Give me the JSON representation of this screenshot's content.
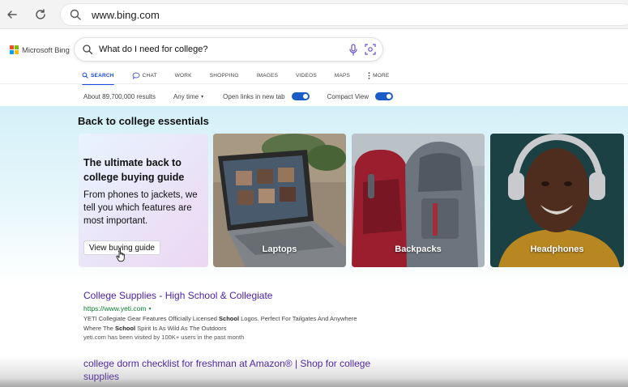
{
  "browser": {
    "url": "www.bing.com"
  },
  "bing": {
    "logo_text": "Microsoft Bing",
    "search_query": "What do I need for college?",
    "tabs": [
      {
        "label": "SEARCH",
        "icon": "search-icon",
        "active": true
      },
      {
        "label": "CHAT",
        "icon": "chat-icon",
        "active": false
      },
      {
        "label": "WORK",
        "icon": "",
        "active": false
      },
      {
        "label": "SHOPPING",
        "icon": "",
        "active": false
      },
      {
        "label": "IMAGES",
        "icon": "",
        "active": false
      },
      {
        "label": "VIDEOS",
        "icon": "",
        "active": false
      },
      {
        "label": "MAPS",
        "icon": "",
        "active": false
      },
      {
        "label": "MORE",
        "icon": "more-vertical-icon",
        "active": false
      }
    ]
  },
  "toolbar": {
    "results_count": "About 89,700,000 results",
    "any_time": "Any time",
    "open_links_label": "Open links in new tab",
    "open_links_on": true,
    "compact_view_label": "Compact View",
    "compact_view_on": true
  },
  "hero": {
    "section_title": "Back to college essentials",
    "guide": {
      "title": "The ultimate back to college buying guide",
      "body": "From phones to jackets, we tell you which features are most important.",
      "button": "View buying guide"
    },
    "cards": [
      {
        "label": "Laptops"
      },
      {
        "label": "Backpacks"
      },
      {
        "label": "Headphones"
      }
    ]
  },
  "results": [
    {
      "title": "College Supplies - High School & Collegiate",
      "url": "https://www.yeti.com",
      "snippet_parts": [
        "YETI Collegiate Gear Features Officially Licensed ",
        "School",
        " Logos. Perfect For Tailgates And Anywhere Where The ",
        "School",
        " Spirit Is As Wild As The Outdoors"
      ],
      "visited_note": "yeti.com has been visited by 100K+ users in the past month"
    },
    {
      "title": "college dorm checklist for freshman at Amazon® | Shop for college supplies"
    }
  ],
  "colors": {
    "accent": "#174ae4",
    "link": "#4a1fa8",
    "url_green": "#0a7f2e",
    "toggle": "#1a5dc6"
  }
}
